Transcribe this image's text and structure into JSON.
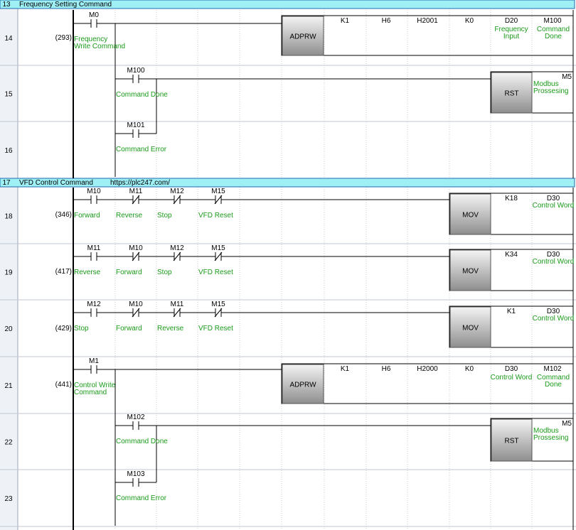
{
  "rows": {
    "r13": "13",
    "r14": "14",
    "r15": "15",
    "r16": "16",
    "r17": "17",
    "r18": "18",
    "r19": "19",
    "r20": "20",
    "r21": "21",
    "r22": "22",
    "r23": "23"
  },
  "headers": {
    "h13": "Frequency Setting Command",
    "h17": "VFD Control Command",
    "h17url": "https://plc247.com/"
  },
  "steps": {
    "s14": "(293)",
    "s18": "(346)",
    "s19": "(417)",
    "s20": "(429)",
    "s21": "(441)"
  },
  "contacts": {
    "r14_m0": {
      "dev": "M0",
      "label": "Frequency Write Command"
    },
    "r15_m100": {
      "dev": "M100",
      "label": "Command Done"
    },
    "r16_m101": {
      "dev": "M101",
      "label": "Command Error"
    },
    "r18_m10": {
      "dev": "M10",
      "label": "Forward"
    },
    "r18_m11": {
      "dev": "M11",
      "label": "Reverse"
    },
    "r18_m12": {
      "dev": "M12",
      "label": "Stop"
    },
    "r18_m15": {
      "dev": "M15",
      "label": "VFD Reset"
    },
    "r19_m11": {
      "dev": "M11",
      "label": "Reverse"
    },
    "r19_m10": {
      "dev": "M10",
      "label": "Forward"
    },
    "r19_m12": {
      "dev": "M12",
      "label": "Stop"
    },
    "r19_m15": {
      "dev": "M15",
      "label": "VFD Reset"
    },
    "r20_m12": {
      "dev": "M12",
      "label": "Stop"
    },
    "r20_m10": {
      "dev": "M10",
      "label": "Forward"
    },
    "r20_m11": {
      "dev": "M11",
      "label": "Reverse"
    },
    "r20_m15": {
      "dev": "M15",
      "label": "VFD Reset"
    },
    "r21_m1": {
      "dev": "M1",
      "label": "Control Write Command"
    },
    "r22_m102": {
      "dev": "M102",
      "label": "Command Done"
    },
    "r23_m103": {
      "dev": "M103",
      "label": "Command Error"
    }
  },
  "instr": {
    "r14": {
      "name": "ADPRW",
      "ops": [
        "K1",
        "H6",
        "H2001",
        "K0",
        "D20",
        "M100"
      ],
      "c1": "Frequency Input",
      "c2": "Command Done"
    },
    "r15": {
      "name": "RST",
      "dev": "M5",
      "comment": "Modbus Prossesing"
    },
    "r18": {
      "name": "MOV",
      "op1": "K18",
      "op2": "D30",
      "comment": "Control Word"
    },
    "r19": {
      "name": "MOV",
      "op1": "K34",
      "op2": "D30",
      "comment": "Control Word"
    },
    "r20": {
      "name": "MOV",
      "op1": "K1",
      "op2": "D30",
      "comment": "Control Word"
    },
    "r21": {
      "name": "ADPRW",
      "ops": [
        "K1",
        "H6",
        "H2000",
        "K0",
        "D30",
        "M102"
      ],
      "c1": "Control Word",
      "c2": "Command Done"
    },
    "r22": {
      "name": "RST",
      "dev": "M5",
      "comment": "Modbus Prossesing"
    }
  },
  "colors": {
    "header_bg": "#9ff0f5",
    "header_border": "#1f6bb0",
    "comment": "#1a9a1a",
    "line": "#000000",
    "grid": "#cfcfcf"
  }
}
